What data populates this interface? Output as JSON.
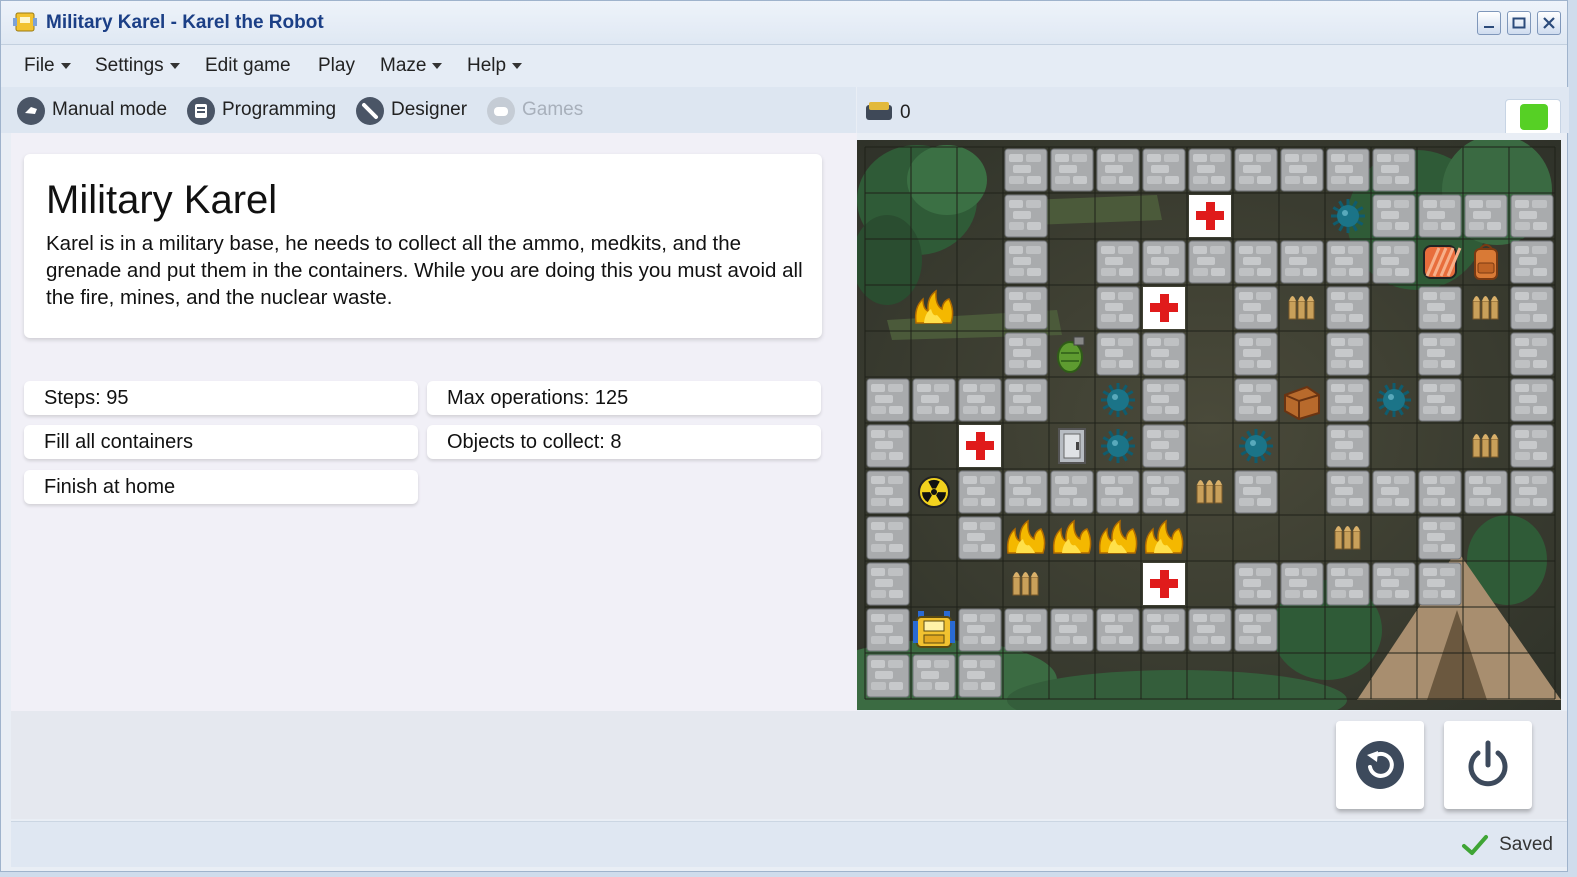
{
  "window": {
    "title": "Military Karel - Karel the Robot"
  },
  "menu": [
    {
      "label": "File",
      "dropdown": true
    },
    {
      "label": "Settings",
      "dropdown": true
    },
    {
      "label": "Edit game",
      "dropdown": false
    },
    {
      "label": "Play",
      "dropdown": false
    },
    {
      "label": "Maze",
      "dropdown": true
    },
    {
      "label": "Help",
      "dropdown": true
    }
  ],
  "modes": [
    {
      "label": "Manual mode",
      "enabled": true,
      "icon": "pointer-icon"
    },
    {
      "label": "Programming",
      "enabled": true,
      "icon": "code-icon"
    },
    {
      "label": "Designer",
      "enabled": true,
      "icon": "pencil-icon"
    },
    {
      "label": "Games",
      "enabled": false,
      "icon": "gamepad-icon"
    }
  ],
  "description": {
    "title": "Military Karel",
    "text": "Karel is in a military base, he needs to collect all the ammo, medkits, and the grenade and put them in  the containers. While you are doing this you must avoid all the fire, mines, and the nuclear waste."
  },
  "stats": {
    "steps": "Steps: 95",
    "max_operations": "Max operations: 125",
    "goal_containers": "Fill all containers",
    "objects_to_collect": "Objects to collect: 8",
    "goal_home": "Finish at home"
  },
  "game": {
    "collected_count": "0",
    "status_color": "#56d025"
  },
  "board": {
    "cols": 15,
    "rows": 12,
    "walls": [
      [
        3,
        0
      ],
      [
        4,
        0
      ],
      [
        5,
        0
      ],
      [
        6,
        0
      ],
      [
        7,
        0
      ],
      [
        8,
        0
      ],
      [
        9,
        0
      ],
      [
        10,
        0
      ],
      [
        11,
        0
      ],
      [
        3,
        1
      ],
      [
        11,
        1
      ],
      [
        12,
        1
      ],
      [
        13,
        1
      ],
      [
        14,
        1
      ],
      [
        3,
        2
      ],
      [
        5,
        2
      ],
      [
        6,
        2
      ],
      [
        7,
        2
      ],
      [
        8,
        2
      ],
      [
        9,
        2
      ],
      [
        10,
        2
      ],
      [
        11,
        2
      ],
      [
        14,
        2
      ],
      [
        3,
        3
      ],
      [
        5,
        3
      ],
      [
        8,
        3
      ],
      [
        10,
        3
      ],
      [
        12,
        3
      ],
      [
        14,
        3
      ],
      [
        3,
        4
      ],
      [
        5,
        4
      ],
      [
        6,
        4
      ],
      [
        8,
        4
      ],
      [
        10,
        4
      ],
      [
        12,
        4
      ],
      [
        14,
        4
      ],
      [
        0,
        5
      ],
      [
        1,
        5
      ],
      [
        2,
        5
      ],
      [
        3,
        5
      ],
      [
        6,
        5
      ],
      [
        8,
        5
      ],
      [
        10,
        5
      ],
      [
        12,
        5
      ],
      [
        14,
        5
      ],
      [
        0,
        6
      ],
      [
        6,
        6
      ],
      [
        10,
        6
      ],
      [
        14,
        6
      ],
      [
        0,
        7
      ],
      [
        2,
        7
      ],
      [
        3,
        7
      ],
      [
        4,
        7
      ],
      [
        5,
        7
      ],
      [
        6,
        7
      ],
      [
        8,
        7
      ],
      [
        10,
        7
      ],
      [
        11,
        7
      ],
      [
        12,
        7
      ],
      [
        13,
        7
      ],
      [
        14,
        7
      ],
      [
        0,
        8
      ],
      [
        2,
        8
      ],
      [
        12,
        8
      ],
      [
        0,
        9
      ],
      [
        8,
        9
      ],
      [
        9,
        9
      ],
      [
        10,
        9
      ],
      [
        11,
        9
      ],
      [
        12,
        9
      ],
      [
        0,
        10
      ],
      [
        2,
        10
      ],
      [
        3,
        10
      ],
      [
        4,
        10
      ],
      [
        5,
        10
      ],
      [
        6,
        10
      ],
      [
        7,
        10
      ],
      [
        8,
        10
      ],
      [
        0,
        11
      ],
      [
        1,
        11
      ],
      [
        2,
        11
      ]
    ],
    "objects": [
      {
        "type": "medkit",
        "col": 7,
        "row": 1
      },
      {
        "type": "medkit",
        "col": 6,
        "row": 3
      },
      {
        "type": "medkit",
        "col": 2,
        "row": 6
      },
      {
        "type": "medkit",
        "col": 6,
        "row": 9
      },
      {
        "type": "mine",
        "col": 10,
        "row": 1
      },
      {
        "type": "mine",
        "col": 5,
        "row": 5
      },
      {
        "type": "mine",
        "col": 11,
        "row": 5
      },
      {
        "type": "mine",
        "col": 5,
        "row": 6
      },
      {
        "type": "mine",
        "col": 8,
        "row": 6
      },
      {
        "type": "ammo",
        "col": 9,
        "row": 3
      },
      {
        "type": "ammo",
        "col": 13,
        "row": 3
      },
      {
        "type": "ammo",
        "col": 13,
        "row": 6
      },
      {
        "type": "ammo",
        "col": 7,
        "row": 7
      },
      {
        "type": "ammo",
        "col": 10,
        "row": 8
      },
      {
        "type": "ammo",
        "col": 3,
        "row": 9
      },
      {
        "type": "fire",
        "col": 3,
        "row": 8
      },
      {
        "type": "fire",
        "col": 4,
        "row": 8
      },
      {
        "type": "fire",
        "col": 5,
        "row": 8
      },
      {
        "type": "fire",
        "col": 6,
        "row": 8
      },
      {
        "type": "fire",
        "col": 1,
        "row": 3
      },
      {
        "type": "grenade",
        "col": 4,
        "row": 4
      },
      {
        "type": "radioactive",
        "col": 1,
        "row": 7
      },
      {
        "type": "safe",
        "col": 4,
        "row": 6
      },
      {
        "type": "crate",
        "col": 9,
        "row": 5
      },
      {
        "type": "container",
        "col": 12,
        "row": 2
      },
      {
        "type": "backpack",
        "col": 13,
        "row": 2
      },
      {
        "type": "karel",
        "col": 1,
        "row": 10
      }
    ]
  },
  "controls": [
    {
      "name": "reset-button",
      "icon": "reset-icon"
    },
    {
      "name": "power-button",
      "icon": "power-icon"
    }
  ],
  "status": {
    "saved": "Saved"
  }
}
